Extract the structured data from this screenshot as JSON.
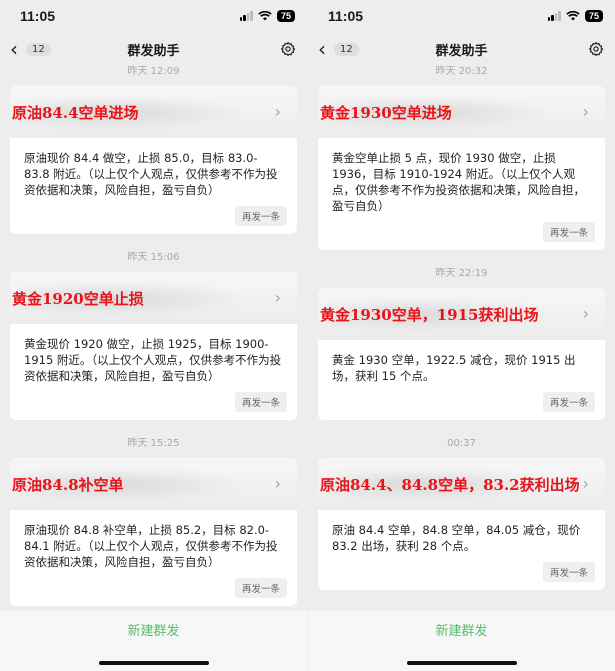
{
  "panes": [
    {
      "status": {
        "time": "11:05",
        "battery": "75"
      },
      "nav": {
        "back_count": "12",
        "title": "群发助手"
      },
      "messages": [
        {
          "time": "昨天 12:09",
          "title": "原油84.4空单进场",
          "body": "原油现价 84.4 做空，止损 85.0，目标 83.0-83.8 附近。（以上仅个人观点，仅供参考不作为投资依据和决策，风险自担，盈亏自负）",
          "resend": "再发一条"
        },
        {
          "time": "昨天 15:06",
          "title": "黄金1920空单止损",
          "body": "黄金现价 1920 做空，止损 1925，目标 1900-1915 附近。（以上仅个人观点，仅供参考不作为投资依据和决策，风险自担，盈亏自负）",
          "resend": "再发一条"
        },
        {
          "time": "昨天 15:25",
          "title": "原油84.8补空单",
          "body": "原油现价 84.8 补空单，止损 85.2，目标 82.0-84.1 附近。（以上仅个人观点，仅供参考不作为投资依据和决策，风险自担，盈亏自负）",
          "resend": "再发一条"
        }
      ],
      "new_group": "新建群发"
    },
    {
      "status": {
        "time": "11:05",
        "battery": "75"
      },
      "nav": {
        "back_count": "12",
        "title": "群发助手"
      },
      "messages": [
        {
          "time": "昨天 20:32",
          "title": "黄金1930空单进场",
          "body": "黄金空单止损 5 点，现价 1930 做空，止损 1936，目标 1910-1924 附近。（以上仅个人观点，仅供参考不作为投资依据和决策，风险自担，盈亏自负）",
          "resend": "再发一条"
        },
        {
          "time": "昨天 22:19",
          "title": "黄金1930空单，1915获利出场",
          "body": "黄金 1930 空单，1922.5 减仓，现价 1915 出场，获利 15 个点。",
          "resend": "再发一条"
        },
        {
          "time": "00:37",
          "title": "原油84.4、84.8空单，83.2获利出场",
          "body": "原油 84.4 空单，84.8 空单，84.05 减仓，现价 83.2 出场，获利 28 个点。",
          "resend": "再发一条"
        }
      ],
      "new_group": "新建群发"
    }
  ]
}
